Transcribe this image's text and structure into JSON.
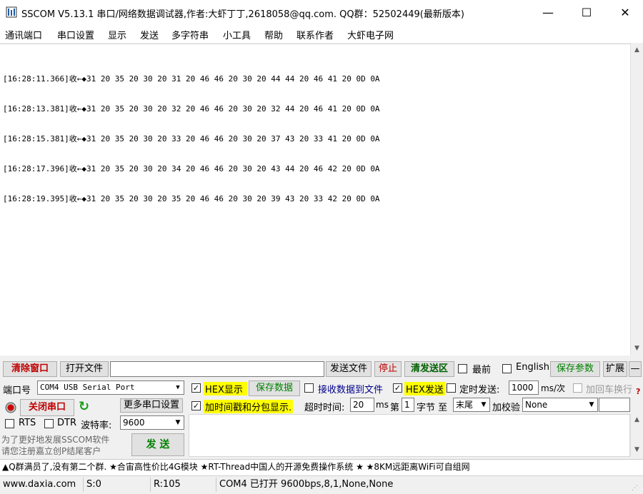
{
  "window": {
    "title": "SSCOM V5.13.1 串口/网络数据调试器,作者:大虾丁丁,2618058@qq.com. QQ群：52502449(最新版本)",
    "minimize": "—",
    "maximize": "☐",
    "close": "✕"
  },
  "menu": [
    "通讯端口",
    "串口设置",
    "显示",
    "发送",
    "多字符串",
    "小工具",
    "帮助",
    "联系作者",
    "大虾电子网"
  ],
  "receive": {
    "lines": [
      "[16:28:11.366]收←◆31 20 35 20 30 20 31 20 46 46 20 30 20 44 44 20 46 41 20 0D 0A",
      "[16:28:13.381]收←◆31 20 35 20 30 20 32 20 46 46 20 30 20 32 44 20 46 41 20 0D 0A",
      "[16:28:15.381]收←◆31 20 35 20 30 20 33 20 46 46 20 30 20 37 43 20 33 41 20 0D 0A",
      "[16:28:17.396]收←◆31 20 35 20 30 20 34 20 46 46 20 30 20 43 44 20 46 42 20 0D 0A",
      "[16:28:19.395]收←◆31 20 35 20 30 20 35 20 46 46 20 30 20 39 43 20 33 42 20 0D 0A"
    ]
  },
  "toolbar": {
    "clear_window": "清除窗口",
    "open_file": "打开文件",
    "file_path": "",
    "send_file": "发送文件",
    "stop": "停止",
    "clear_send": "清发送区",
    "topmost": "最前",
    "english": "English",
    "save_params": "保存参数",
    "expand": "扩展",
    "collapse": "—"
  },
  "port": {
    "port_label": "端口号",
    "port_value": "COM4 USB Serial Port",
    "close_port": "关闭串口",
    "more_settings": "更多串口设置",
    "rts": "RTS",
    "dtr": "DTR",
    "baud_label": "波特率:",
    "baud_value": "9600",
    "promo": [
      "为了更好地发展SSCOM软件",
      "请您注册嘉立创P结尾客户"
    ],
    "send": "发  送"
  },
  "options": {
    "hex_display": "HEX显示",
    "save_data": "保存数据",
    "recv_to_file": "接收数据到文件",
    "hex_send": "HEX发送",
    "timed_send": "定时发送:",
    "interval": "1000",
    "interval_unit": "ms/次",
    "add_crlf": "加回车换行",
    "timestamp": "加时间戳和分包显示.",
    "timeout_label": "超时时间:",
    "timeout_value": "20",
    "timeout_unit": "ms",
    "nth_label": "第",
    "nth_value": "1",
    "byte_label": "字节  至",
    "end_value": "末尾",
    "checksum_label": "加校验",
    "checksum_value": "None"
  },
  "ticker": "▲Q群满员了,没有第二个群. ★合宙高性价比4G模块 ★RT-Thread中国人的开源免费操作系统 ★ ★8KM远距离WiFi可自组网",
  "status": {
    "website": "www.daxia.com",
    "sent": "S:0",
    "received": "R:105",
    "port_state": "COM4 已打开  9600bps,8,1,None,None"
  },
  "colors": {
    "highlight": "#ffff00",
    "button_red": "#c00000",
    "button_green": "#008000"
  }
}
